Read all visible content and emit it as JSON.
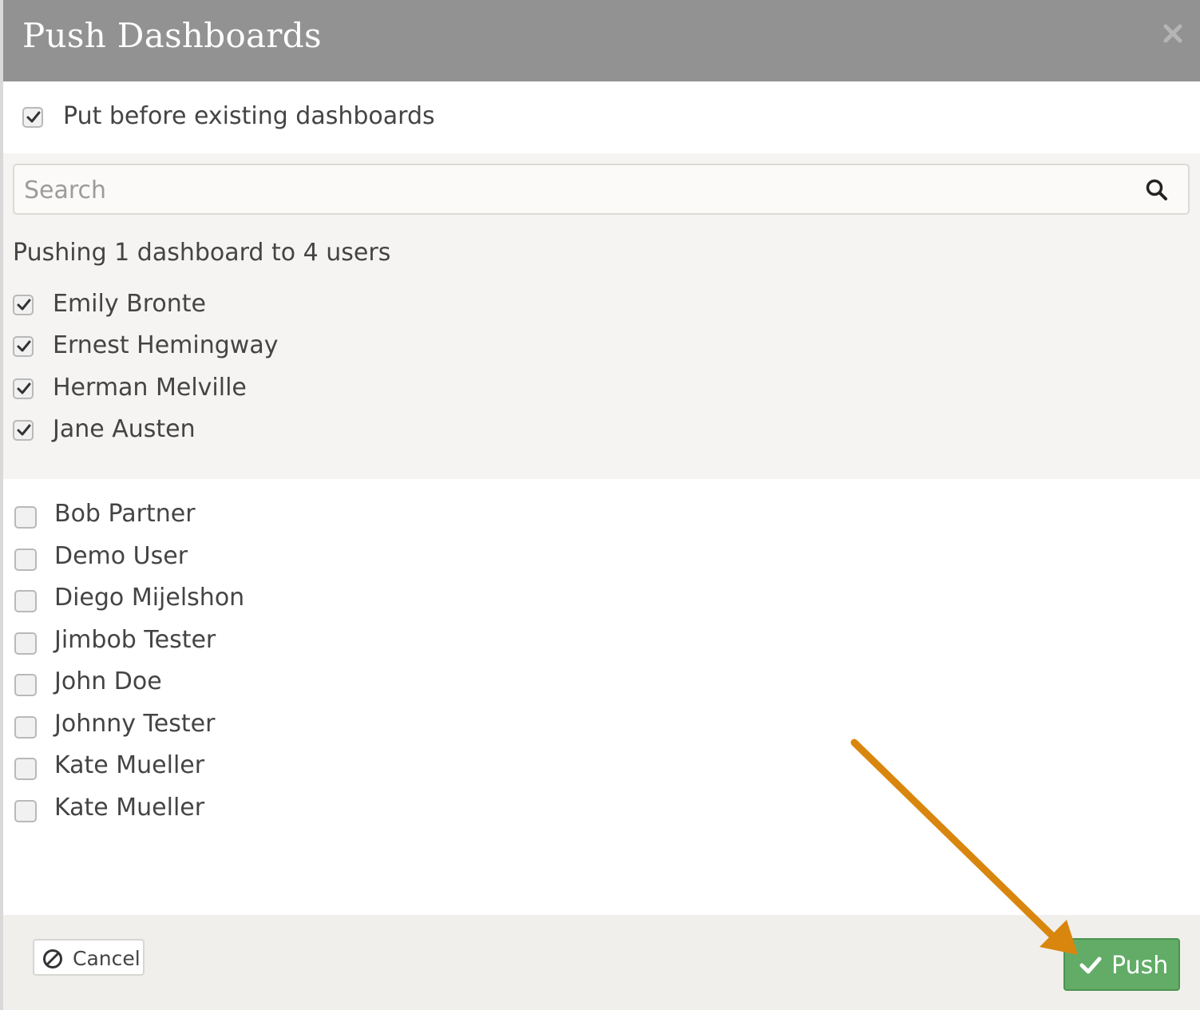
{
  "dialog": {
    "title": "Push Dashboards"
  },
  "options": {
    "put_before_label": "Put before existing dashboards",
    "put_before_checked": true
  },
  "search": {
    "placeholder": "Search",
    "value": ""
  },
  "summary": "Pushing 1 dashboard to 4 users",
  "selected_users": [
    {
      "name": "Emily Bronte",
      "checked": true
    },
    {
      "name": "Ernest Hemingway",
      "checked": true
    },
    {
      "name": "Herman Melville",
      "checked": true
    },
    {
      "name": "Jane Austen",
      "checked": true
    }
  ],
  "unselected_users": [
    {
      "name": "Bob Partner",
      "checked": false
    },
    {
      "name": "Demo User",
      "checked": false
    },
    {
      "name": "Diego Mijelshon",
      "checked": false
    },
    {
      "name": "Jimbob Tester",
      "checked": false
    },
    {
      "name": "John Doe",
      "checked": false
    },
    {
      "name": "Johnny Tester",
      "checked": false
    },
    {
      "name": "Kate Mueller",
      "checked": false
    },
    {
      "name": "Kate Mueller",
      "checked": false
    }
  ],
  "footer": {
    "cancel_label": "Cancel",
    "push_label": "Push"
  },
  "icons": {
    "close": "close-icon",
    "search": "search-icon",
    "cancel": "ban-icon",
    "push": "check-icon",
    "annotation": "arrow-annotation"
  },
  "colors": {
    "header_bg": "#929292",
    "push_button": "#62ac67",
    "annotation_arrow": "#d9860f"
  }
}
